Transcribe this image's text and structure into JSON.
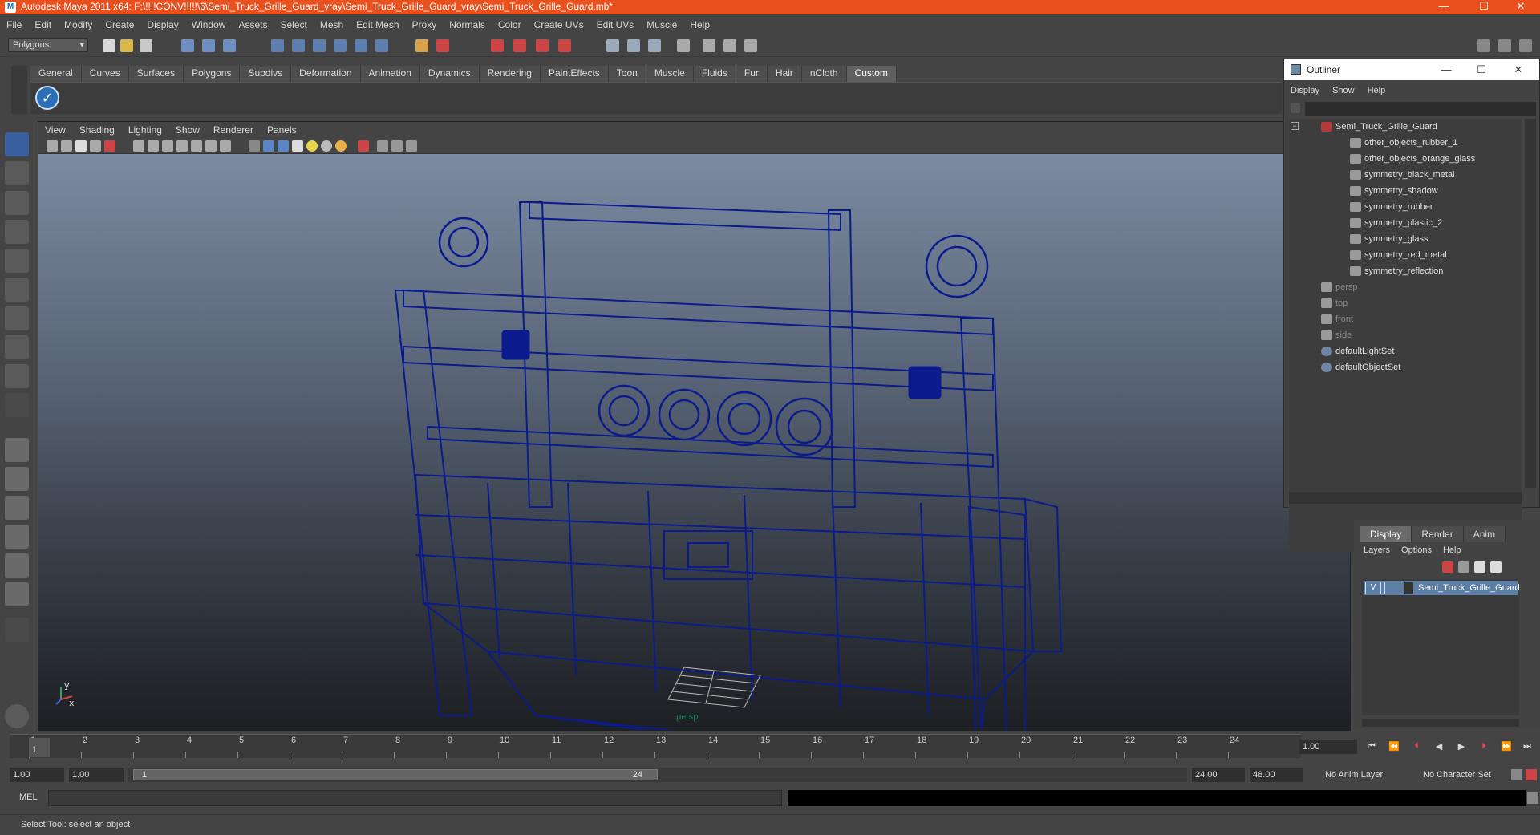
{
  "window": {
    "title": "Autodesk Maya 2011 x64: F:\\!!!!CONV!!!!!\\6\\Semi_Truck_Grille_Guard_vray\\Semi_Truck_Grille_Guard_vray\\Semi_Truck_Grille_Guard.mb*"
  },
  "menubar": [
    "File",
    "Edit",
    "Modify",
    "Create",
    "Display",
    "Window",
    "Assets",
    "Select",
    "Mesh",
    "Edit Mesh",
    "Proxy",
    "Normals",
    "Color",
    "Create UVs",
    "Edit UVs",
    "Muscle",
    "Help"
  ],
  "statusline": {
    "mode": "Polygons"
  },
  "shelf": {
    "tabs": [
      "General",
      "Curves",
      "Surfaces",
      "Polygons",
      "Subdivs",
      "Deformation",
      "Animation",
      "Dynamics",
      "Rendering",
      "PaintEffects",
      "Toon",
      "Muscle",
      "Fluids",
      "Fur",
      "Hair",
      "nCloth",
      "Custom"
    ],
    "active": "Custom"
  },
  "viewport": {
    "menu": [
      "View",
      "Shading",
      "Lighting",
      "Show",
      "Renderer",
      "Panels"
    ],
    "camera_label": "persp",
    "axis_x": "x",
    "axis_y": "y"
  },
  "outliner": {
    "title": "Outliner",
    "menu": [
      "Display",
      "Show",
      "Help"
    ],
    "items": [
      {
        "label": "Semi_Truck_Grille_Guard",
        "kind": "group",
        "indent": 0,
        "dim": false
      },
      {
        "label": "other_objects_rubber_1",
        "kind": "mesh",
        "indent": 1,
        "dim": false
      },
      {
        "label": "other_objects_orange_glass",
        "kind": "mesh",
        "indent": 1,
        "dim": false
      },
      {
        "label": "symmetry_black_metal",
        "kind": "mesh",
        "indent": 1,
        "dim": false
      },
      {
        "label": "symmetry_shadow",
        "kind": "mesh",
        "indent": 1,
        "dim": false
      },
      {
        "label": "symmetry_rubber",
        "kind": "mesh",
        "indent": 1,
        "dim": false
      },
      {
        "label": "symmetry_plastic_2",
        "kind": "mesh",
        "indent": 1,
        "dim": false
      },
      {
        "label": "symmetry_glass",
        "kind": "mesh",
        "indent": 1,
        "dim": false
      },
      {
        "label": "symmetry_red_metal",
        "kind": "mesh",
        "indent": 1,
        "dim": false
      },
      {
        "label": "symmetry_reflection",
        "kind": "mesh",
        "indent": 1,
        "dim": false
      },
      {
        "label": "persp",
        "kind": "camera",
        "indent": 0,
        "dim": true
      },
      {
        "label": "top",
        "kind": "camera",
        "indent": 0,
        "dim": true
      },
      {
        "label": "front",
        "kind": "camera",
        "indent": 0,
        "dim": true
      },
      {
        "label": "side",
        "kind": "camera",
        "indent": 0,
        "dim": true
      },
      {
        "label": "defaultLightSet",
        "kind": "set",
        "indent": 0,
        "dim": false
      },
      {
        "label": "defaultObjectSet",
        "kind": "set",
        "indent": 0,
        "dim": false
      }
    ]
  },
  "layer_editor": {
    "tabs": [
      "Display",
      "Render",
      "Anim"
    ],
    "active_tab": "Display",
    "menu": [
      "Layers",
      "Options",
      "Help"
    ],
    "layer": {
      "visible": "V",
      "name": "Semi_Truck_Grille_Guard"
    }
  },
  "timeline": {
    "ticks": [
      "1",
      "2",
      "3",
      "4",
      "5",
      "6",
      "7",
      "8",
      "9",
      "10",
      "11",
      "12",
      "13",
      "14",
      "15",
      "16",
      "17",
      "18",
      "19",
      "20",
      "21",
      "22",
      "23",
      "24"
    ],
    "current_marker": "1",
    "current_time": "1.00"
  },
  "range": {
    "start": "1.00",
    "playback_start": "1.00",
    "thumb_start": "1",
    "thumb_end": "24",
    "playback_end": "24.00",
    "end": "48.00",
    "anim_layer": "No Anim Layer",
    "character_set": "No Character Set"
  },
  "cmdline": {
    "label": "MEL"
  },
  "helpline": {
    "text": "Select Tool: select an object"
  },
  "colors": {
    "titlebar": "#e8501e",
    "wireframe": "#0b1a8c",
    "selected_layer": "#5d7fa6"
  }
}
